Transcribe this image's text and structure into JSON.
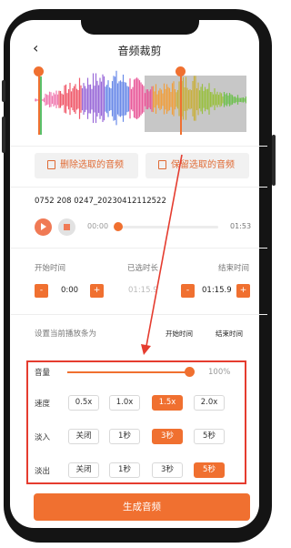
{
  "header": {
    "title": "音频裁剪"
  },
  "waveform": {
    "accent": "#f07030",
    "selected_region": "#c7c7c7"
  },
  "actions": {
    "delete_label": "删除选取的音频",
    "keep_label": "保留选取的音频"
  },
  "file": {
    "name": "0752 208 0247_20230412112522"
  },
  "player": {
    "current_time": "00:00",
    "total_time": "01:53",
    "progress": 0.0
  },
  "selection": {
    "start_label": "开始时间",
    "selected_label": "已选时长",
    "end_label": "结束时间",
    "start_value": "0:00",
    "selected_value": "01:15.9",
    "end_value": "01:15.9",
    "minus": "-",
    "plus": "+"
  },
  "set_current": {
    "label": "设置当前播放条为",
    "start_btn": "开始时间",
    "end_btn": "结束时间"
  },
  "settings": {
    "volume": {
      "label": "音量",
      "value": "100%",
      "level": 1.0
    },
    "speed": {
      "label": "速度",
      "options": [
        "0.5x",
        "1.0x",
        "1.5x",
        "2.0x"
      ],
      "selected": 2
    },
    "fade_in": {
      "label": "淡入",
      "options": [
        "关闭",
        "1秒",
        "3秒",
        "5秒"
      ],
      "selected": 2
    },
    "fade_out": {
      "label": "淡出",
      "options": [
        "关闭",
        "1秒",
        "3秒",
        "5秒"
      ],
      "selected": 3
    }
  },
  "generate": {
    "label": "生成音频"
  },
  "colors": {
    "accent": "#f07030",
    "highlight": "#e53c2f"
  }
}
